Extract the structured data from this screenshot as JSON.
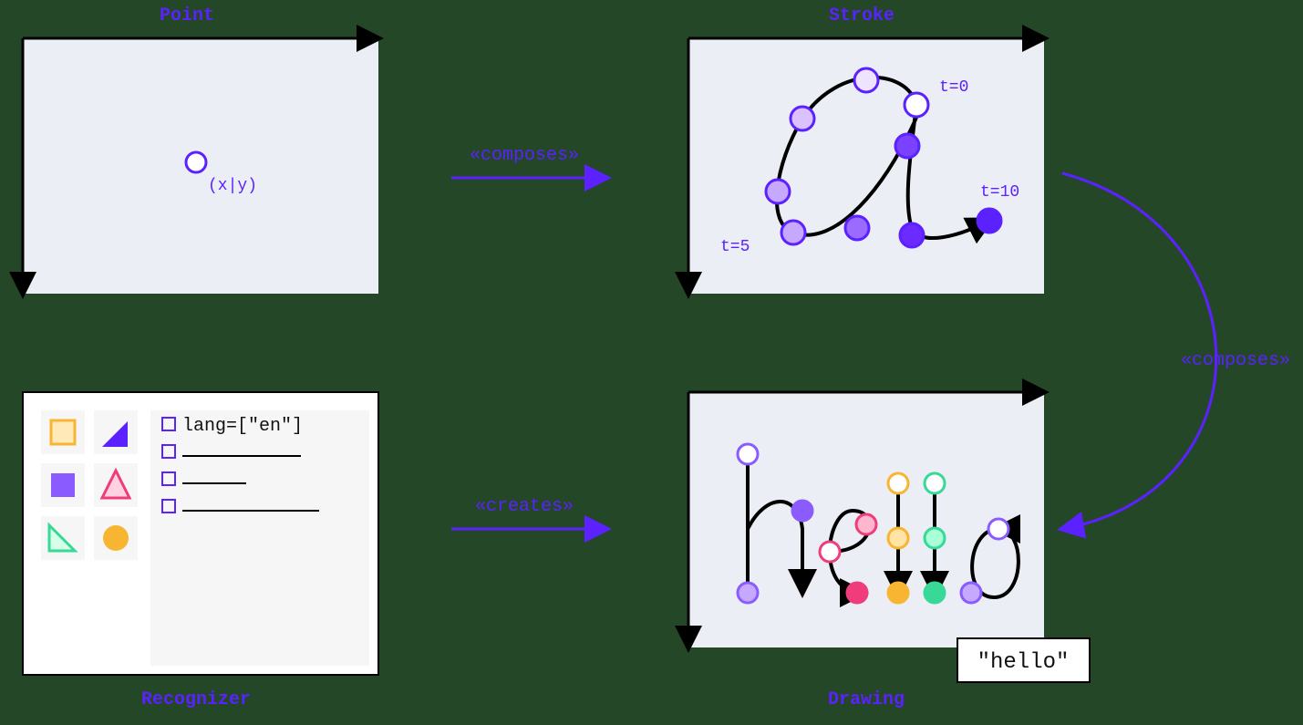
{
  "titles": {
    "point": "Point",
    "stroke": "Stroke",
    "recognizer": "Recognizer",
    "drawing": "Drawing"
  },
  "arrows": {
    "composes1": "«composes»",
    "composes2": "«composes»",
    "creates": "«creates»"
  },
  "point_panel": {
    "coord_label": "(x|y)"
  },
  "stroke_panel": {
    "t_start": "t=0",
    "t_mid": "t=5",
    "t_end": "t=10"
  },
  "drawing_panel": {
    "result_text": "\"hello\""
  },
  "recognizer_panel": {
    "config_line": "lang=[\"en\"]"
  },
  "colors": {
    "accent": "#5b21ff",
    "panel_bg": "#eceef6",
    "white": "#ffffff",
    "black": "#000000",
    "orange": "#f7b531",
    "pink": "#ee3d7a",
    "green": "#38d996",
    "purple_light": "#c7a8ff",
    "purple_mid": "#9b6bff",
    "purple_dark": "#6b2bff"
  }
}
